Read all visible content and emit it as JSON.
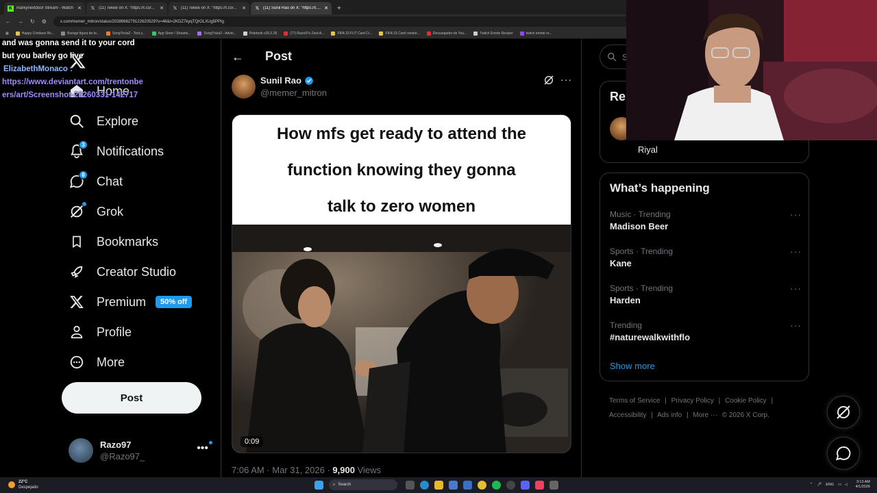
{
  "browser": {
    "tabs": [
      {
        "title": "markynextdoor Stream - Watch",
        "active": false
      },
      {
        "title": "(11) Tekee on X: \"https://t.co/...",
        "active": false
      },
      {
        "title": "(11) Tekee on X: \"https://t.co/...",
        "active": false
      },
      {
        "title": "(11) Sunil Rao on X: \"https://t.c...",
        "active": true
      }
    ],
    "url": "x.com/memer_mitron/status/2038966279122620529?s=46&t=2KDZ7kyqTQrOLXUg5PPIg",
    "bookmarks": [
      "Happy Cristiano Ro...",
      "Burago figura de to...",
      "SongTrivia2 - Test y...",
      "App Store / Streami...",
      "SongTrivia2 - Advin...",
      "Peletoob v26.0.28",
      "(77) Razo97s Zest-A...",
      "FIFA 23 FUT Card Cr...",
      "FIFA 23 Card creator...",
      "Descargador de You...",
      "Twitch Emote Resizer",
      "twitch emote re..."
    ]
  },
  "chat": {
    "line1": "and was gonna send it to your cord",
    "line2": "but you barley go live",
    "user": "ElizabethMonaco :",
    "link": "https://www.deviantart.com/trentonbeers/art/Screenshot-20260331-142717"
  },
  "nav": {
    "items": [
      {
        "label": "Home",
        "icon": "home-icon"
      },
      {
        "label": "Explore",
        "icon": "search-icon"
      },
      {
        "label": "Notifications",
        "icon": "bell-icon",
        "badge": "3"
      },
      {
        "label": "Chat",
        "icon": "chat-icon",
        "badge": "8"
      },
      {
        "label": "Grok",
        "icon": "grok-icon"
      },
      {
        "label": "Bookmarks",
        "icon": "bookmark-icon"
      },
      {
        "label": "Creator Studio",
        "icon": "rocket-icon"
      },
      {
        "label": "Premium",
        "icon": "x-icon",
        "pill": "50% off"
      },
      {
        "label": "Profile",
        "icon": "person-icon"
      },
      {
        "label": "More",
        "icon": "more-circle-icon"
      }
    ],
    "post_label": "Post",
    "account": {
      "name": "Razo97",
      "handle": "@Razo97_"
    }
  },
  "post": {
    "header": "Post",
    "author": {
      "name": "Sunil Rao",
      "handle": "@memer_mitron"
    },
    "caption_lines": [
      "How mfs get ready to attend the",
      "function knowing they gonna",
      "talk to zero women"
    ],
    "video_time": "0:09",
    "timestamp": "7:06 AM · Mar 31, 2026 · ",
    "views_count": "9,900",
    "views_label": " Views"
  },
  "right": {
    "search_placeholder": "Se",
    "relevant_title": "Rel",
    "relevant_name": "Riyal",
    "happening_title": "What’s happening",
    "trends": [
      {
        "category": "Music · Trending",
        "name": "Madison Beer"
      },
      {
        "category": "Sports · Trending",
        "name": "Kane"
      },
      {
        "category": "Sports · Trending",
        "name": "Harden"
      },
      {
        "category": "Trending",
        "name": "#naturewalkwithflo"
      }
    ],
    "show_more": "Show more",
    "footer": [
      "Terms of Service",
      "|",
      "Privacy Policy",
      "|",
      "Cookie Policy",
      "|",
      "Accessibility",
      "|",
      "Ads info",
      "|",
      "More ···",
      "© 2026 X Corp."
    ]
  },
  "taskbar": {
    "temp": "22°C",
    "weather": "Despejado",
    "search": "Search",
    "lang": "ENG",
    "time": "3:13 AM",
    "date": "4/1/2026"
  }
}
